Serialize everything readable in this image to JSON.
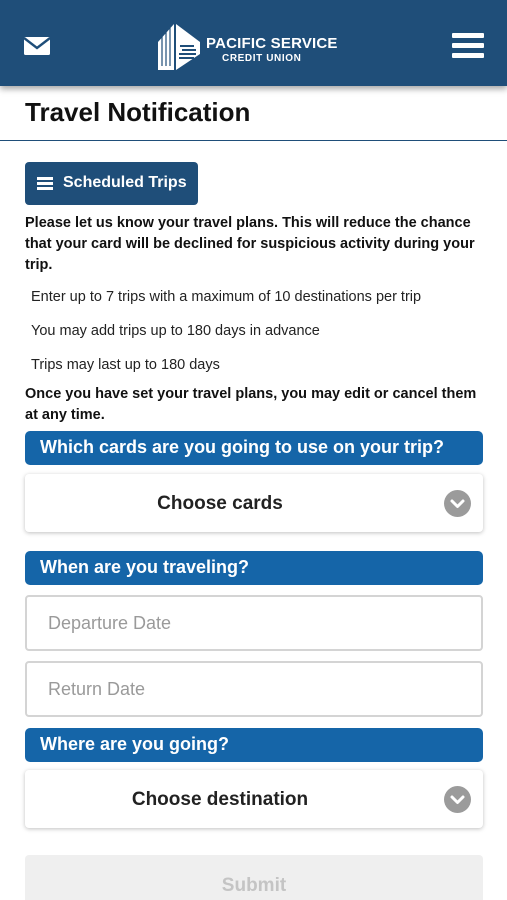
{
  "header": {
    "logo_name": "PACIFIC SERVICE",
    "logo_sub": "CREDIT UNION",
    "mail_icon": "mail-icon",
    "menu_icon": "hamburger-menu-icon",
    "background_color": "#1f4e79"
  },
  "page": {
    "title": "Travel Notification"
  },
  "scheduled_trips": {
    "label": "Scheduled Trips",
    "icon": "list-icon"
  },
  "info": {
    "intro": "Please let us know your travel plans. This will reduce the chance that your card will be declined for suspicious activity during your trip.",
    "bullets": [
      "Enter up to 7 trips with a maximum of 10 destinations per trip",
      "You may add trips up to 180 days in advance",
      "Trips may last up to 180 days"
    ],
    "outro": "Once you have set your travel plans, you may edit or cancel them at any time."
  },
  "cards_section": {
    "heading": "Which cards are you going to use on your trip?",
    "select_label": "Choose cards",
    "icon": "chevron-down-icon"
  },
  "dates_section": {
    "heading": "When are you traveling?",
    "departure_placeholder": "Departure Date",
    "departure_value": "",
    "return_placeholder": "Return Date",
    "return_value": ""
  },
  "destination_section": {
    "heading": "Where are you going?",
    "select_label": "Choose destination",
    "icon": "chevron-down-icon"
  },
  "submit": {
    "label": "Submit"
  },
  "colors": {
    "header": "#1f4e79",
    "section_bar": "#1565a8",
    "chevron": "#9b9b9b",
    "submit_disabled_bg": "#efefef"
  }
}
